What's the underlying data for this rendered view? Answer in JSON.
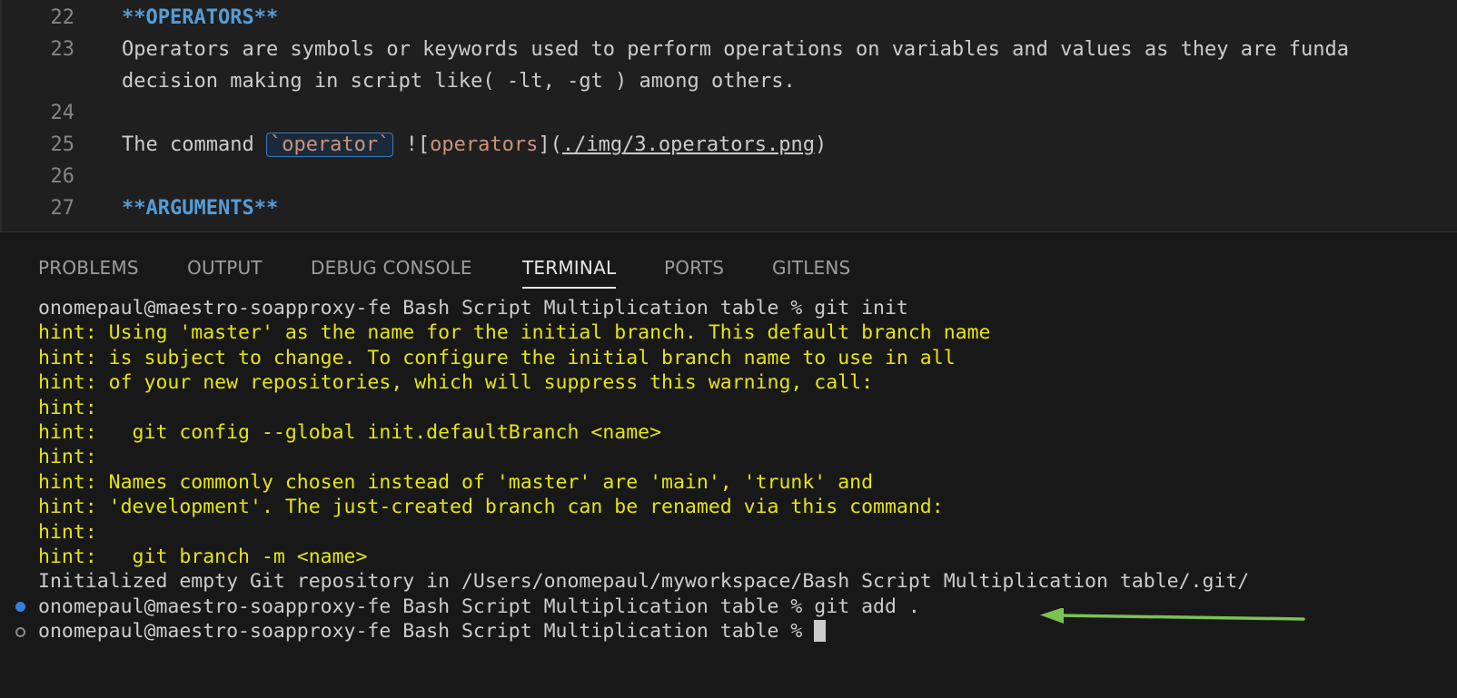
{
  "editor": {
    "lines": [
      {
        "num": "22",
        "segments": [
          {
            "t": "**OPERATORS**",
            "s": "bold"
          }
        ]
      },
      {
        "num": "23",
        "segments": [
          {
            "t": "Operators are symbols or keywords used to perform operations on variables and values as they are funda",
            "s": "plain"
          }
        ]
      },
      {
        "num": "",
        "segments": [
          {
            "t": "decision making in script like( -lt, -gt ) among others.",
            "s": "plain"
          }
        ]
      },
      {
        "num": "24",
        "segments": []
      },
      {
        "num": "25",
        "segments": [
          {
            "t": "The command ",
            "s": "plain"
          },
          {
            "t": "`operator`",
            "s": "code"
          },
          {
            "t": " ![",
            "s": "plain"
          },
          {
            "t": "operators",
            "s": "linktext"
          },
          {
            "t": "](",
            "s": "plain"
          },
          {
            "t": "./img/3.operators.png",
            "s": "url"
          },
          {
            "t": ")",
            "s": "plain"
          }
        ]
      },
      {
        "num": "26",
        "segments": []
      },
      {
        "num": "27",
        "segments": [
          {
            "t": "**ARGUMENTS**",
            "s": "bold"
          }
        ]
      }
    ]
  },
  "panel": {
    "tabs": [
      {
        "label": "PROBLEMS",
        "active": false
      },
      {
        "label": "OUTPUT",
        "active": false
      },
      {
        "label": "DEBUG CONSOLE",
        "active": false
      },
      {
        "label": "TERMINAL",
        "active": true
      },
      {
        "label": "PORTS",
        "active": false
      },
      {
        "label": "GITLENS",
        "active": false
      }
    ]
  },
  "terminal": {
    "lines": [
      {
        "text": "onomepaul@maestro-soapproxy-fe Bash Script Multiplication table % git init",
        "type": "prompt",
        "marker": "none"
      },
      {
        "text": "hint: Using 'master' as the name for the initial branch. This default branch name",
        "type": "hint",
        "marker": "none"
      },
      {
        "text": "hint: is subject to change. To configure the initial branch name to use in all",
        "type": "hint",
        "marker": "none"
      },
      {
        "text": "hint: of your new repositories, which will suppress this warning, call:",
        "type": "hint",
        "marker": "none"
      },
      {
        "text": "hint:",
        "type": "hint",
        "marker": "none"
      },
      {
        "text": "hint:   git config --global init.defaultBranch <name>",
        "type": "hint",
        "marker": "none"
      },
      {
        "text": "hint:",
        "type": "hint",
        "marker": "none"
      },
      {
        "text": "hint: Names commonly chosen instead of 'master' are 'main', 'trunk' and",
        "type": "hint",
        "marker": "none"
      },
      {
        "text": "hint: 'development'. The just-created branch can be renamed via this command:",
        "type": "hint",
        "marker": "none"
      },
      {
        "text": "hint:",
        "type": "hint",
        "marker": "none"
      },
      {
        "text": "hint:   git branch -m <name>",
        "type": "hint",
        "marker": "none"
      },
      {
        "text": "Initialized empty Git repository in /Users/onomepaul/myworkspace/Bash Script Multiplication table/.git/",
        "type": "output",
        "marker": "none"
      },
      {
        "text": "onomepaul@maestro-soapproxy-fe Bash Script Multiplication table % git add .",
        "type": "prompt",
        "marker": "filled"
      },
      {
        "text": "onomepaul@maestro-soapproxy-fe Bash Script Multiplication table % ",
        "type": "prompt",
        "marker": "hollow",
        "cursor": true
      }
    ]
  },
  "colors": {
    "hint": "#e5e510",
    "arrow": "#7cc250",
    "accent": "#3794ff"
  },
  "icons": {
    "annotation": "left-arrow-icon",
    "command-success-marker": "circle-filled-icon",
    "command-pending-marker": "circle-outline-icon"
  }
}
